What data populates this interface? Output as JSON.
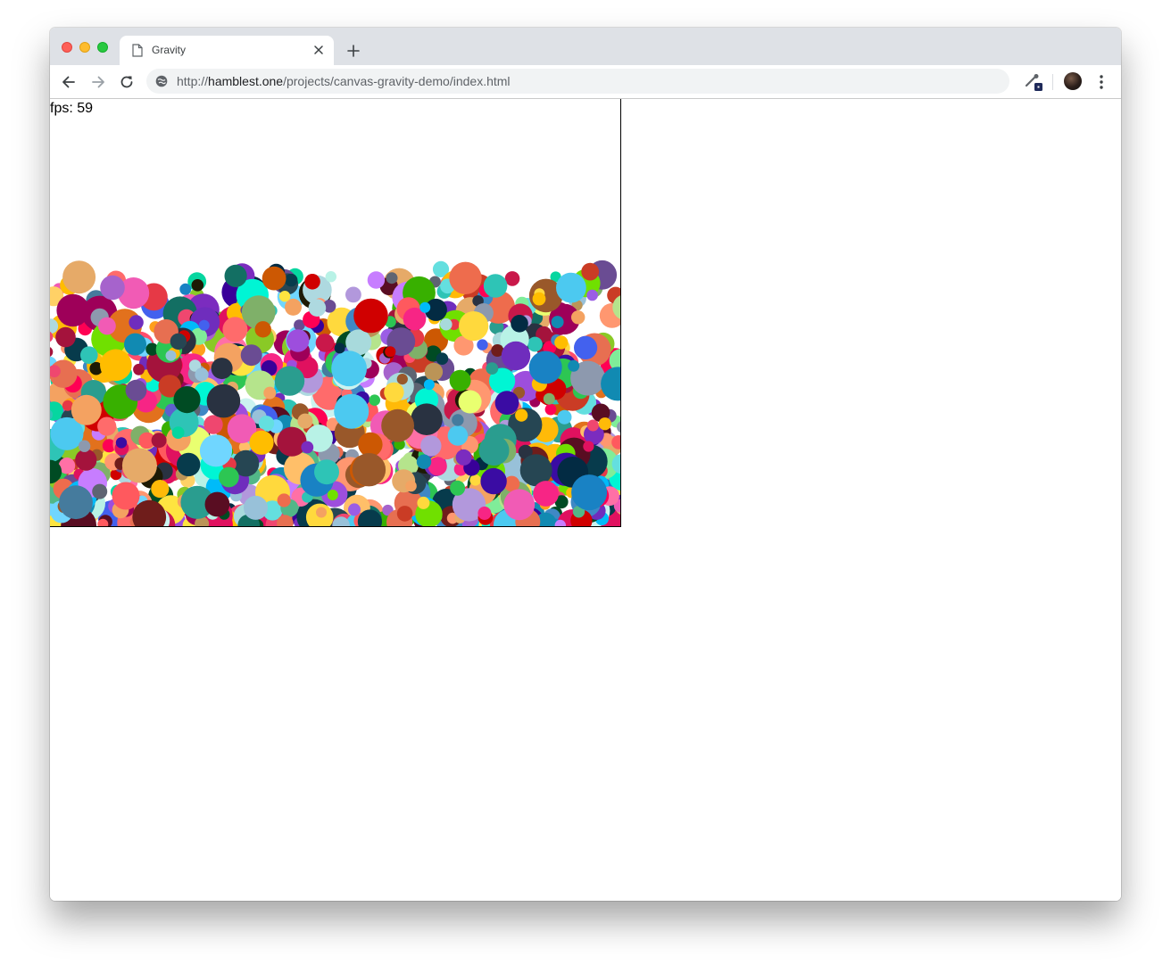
{
  "browser": {
    "tab": {
      "title": "Gravity",
      "close_glyph": "×"
    },
    "new_tab_glyph": "+",
    "address": {
      "scheme": "http://",
      "host": "hamblest.one",
      "path": "/projects/canvas-gravity-demo/index.html"
    },
    "icons": [
      "page-icon",
      "close-icon",
      "plus-icon",
      "back-arrow-icon",
      "forward-arrow-icon",
      "reload-icon",
      "site-info-icon",
      "extension-icon",
      "profile-avatar",
      "more-vert-icon"
    ]
  },
  "page": {
    "fps_label": "fps: 59"
  },
  "canvas": {
    "ball_colors": [
      "#e0115f",
      "#7b2cbf",
      "#2a9d8f",
      "#f4a261",
      "#e63946",
      "#457b9d",
      "#a8dadc",
      "#52b788",
      "#ff6b6b",
      "#ffd93d",
      "#6a4c93",
      "#1982c4",
      "#8ac926",
      "#ff595e",
      "#c77dff",
      "#4cc9f0",
      "#3a0ca3",
      "#f72585",
      "#4361ee",
      "#b5e48c",
      "#99582a",
      "#6f1d1b",
      "#bb9457",
      "#264653",
      "#e76f51",
      "#06d6a0",
      "#118ab2",
      "#ef476f",
      "#ffd166",
      "#073b4c",
      "#9d4edd",
      "#80ed99",
      "#ff9f1c",
      "#2ec4b6",
      "#cbf3f0",
      "#ffbf69",
      "#5e60ce",
      "#64dfdf",
      "#d00000",
      "#ffba08",
      "#3f88c5",
      "#032b43",
      "#136f63",
      "#a4133c",
      "#ff4d6d",
      "#c9184a",
      "#590d22",
      "#b8f2e6",
      "#aed9e0",
      "#5e6472",
      "#7fb069",
      "#e6aa68",
      "#ca3c25",
      "#1d1a05",
      "#8d99ae",
      "#ee6c4d",
      "#98c1d9",
      "#293241",
      "#f15bb5",
      "#00bbf9",
      "#00f5d4",
      "#9b5de5",
      "#fee440",
      "#70e000",
      "#38b000",
      "#004b23",
      "#ff0054",
      "#390099",
      "#9e0059",
      "#ffbd00",
      "#cc5803",
      "#e2711d",
      "#b298dc",
      "#a663cc",
      "#6f2dbd",
      "#2dc653",
      "#ff70a6",
      "#ff9770",
      "#e9ff70",
      "#70d6ff"
    ]
  }
}
